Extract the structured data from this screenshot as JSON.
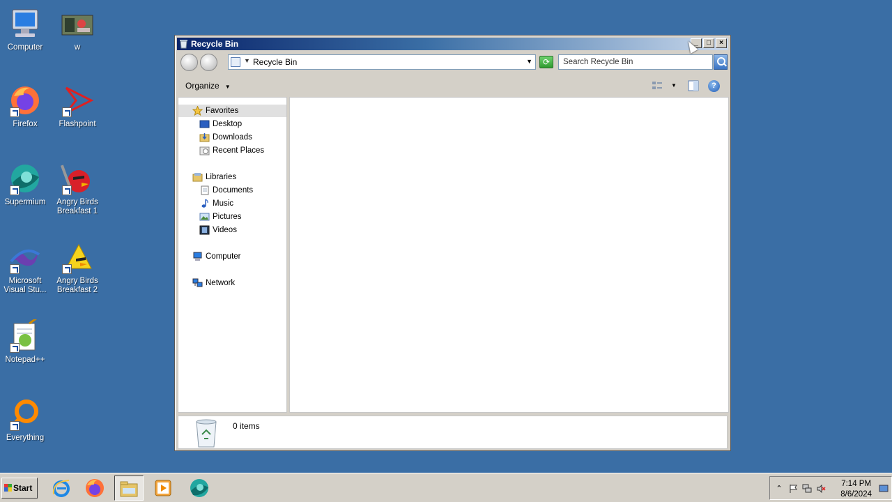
{
  "desktop": {
    "icons": [
      {
        "label": "Computer",
        "icon": "computer-icon"
      },
      {
        "label": "w",
        "icon": "image-icon"
      },
      {
        "label": "Firefox",
        "icon": "firefox-icon"
      },
      {
        "label": "Flashpoint",
        "icon": "flashpoint-icon"
      },
      {
        "label": "Supermium",
        "icon": "supermium-icon"
      },
      {
        "label": "Angry Birds Breakfast 1",
        "icon": "angry-birds-red-icon"
      },
      {
        "label": "Microsoft Visual Stu...",
        "icon": "visual-studio-icon"
      },
      {
        "label": "Angry Birds Breakfast 2",
        "icon": "angry-birds-yellow-icon"
      },
      {
        "label": "Notepad++",
        "icon": "notepad-plus-plus-icon"
      },
      {
        "label": "Everything",
        "icon": "everything-search-icon"
      }
    ]
  },
  "window": {
    "title": "Recycle Bin",
    "address": "Recycle Bin",
    "search_placeholder": "Search Recycle Bin",
    "organize_label": "Organize",
    "help_label": "?",
    "nav": {
      "favorites": {
        "label": "Favorites",
        "items": [
          "Desktop",
          "Downloads",
          "Recent Places"
        ]
      },
      "libraries": {
        "label": "Libraries",
        "items": [
          "Documents",
          "Music",
          "Pictures",
          "Videos"
        ]
      },
      "computer": "Computer",
      "network": "Network"
    },
    "details": {
      "item_count": "0 items"
    }
  },
  "taskbar": {
    "start_label": "Start",
    "apps": [
      "internet-explorer-icon",
      "firefox-icon",
      "windows-explorer-icon",
      "media-player-icon",
      "supermium-icon"
    ],
    "clock": {
      "time": "7:14 PM",
      "date": "8/6/2024"
    }
  }
}
